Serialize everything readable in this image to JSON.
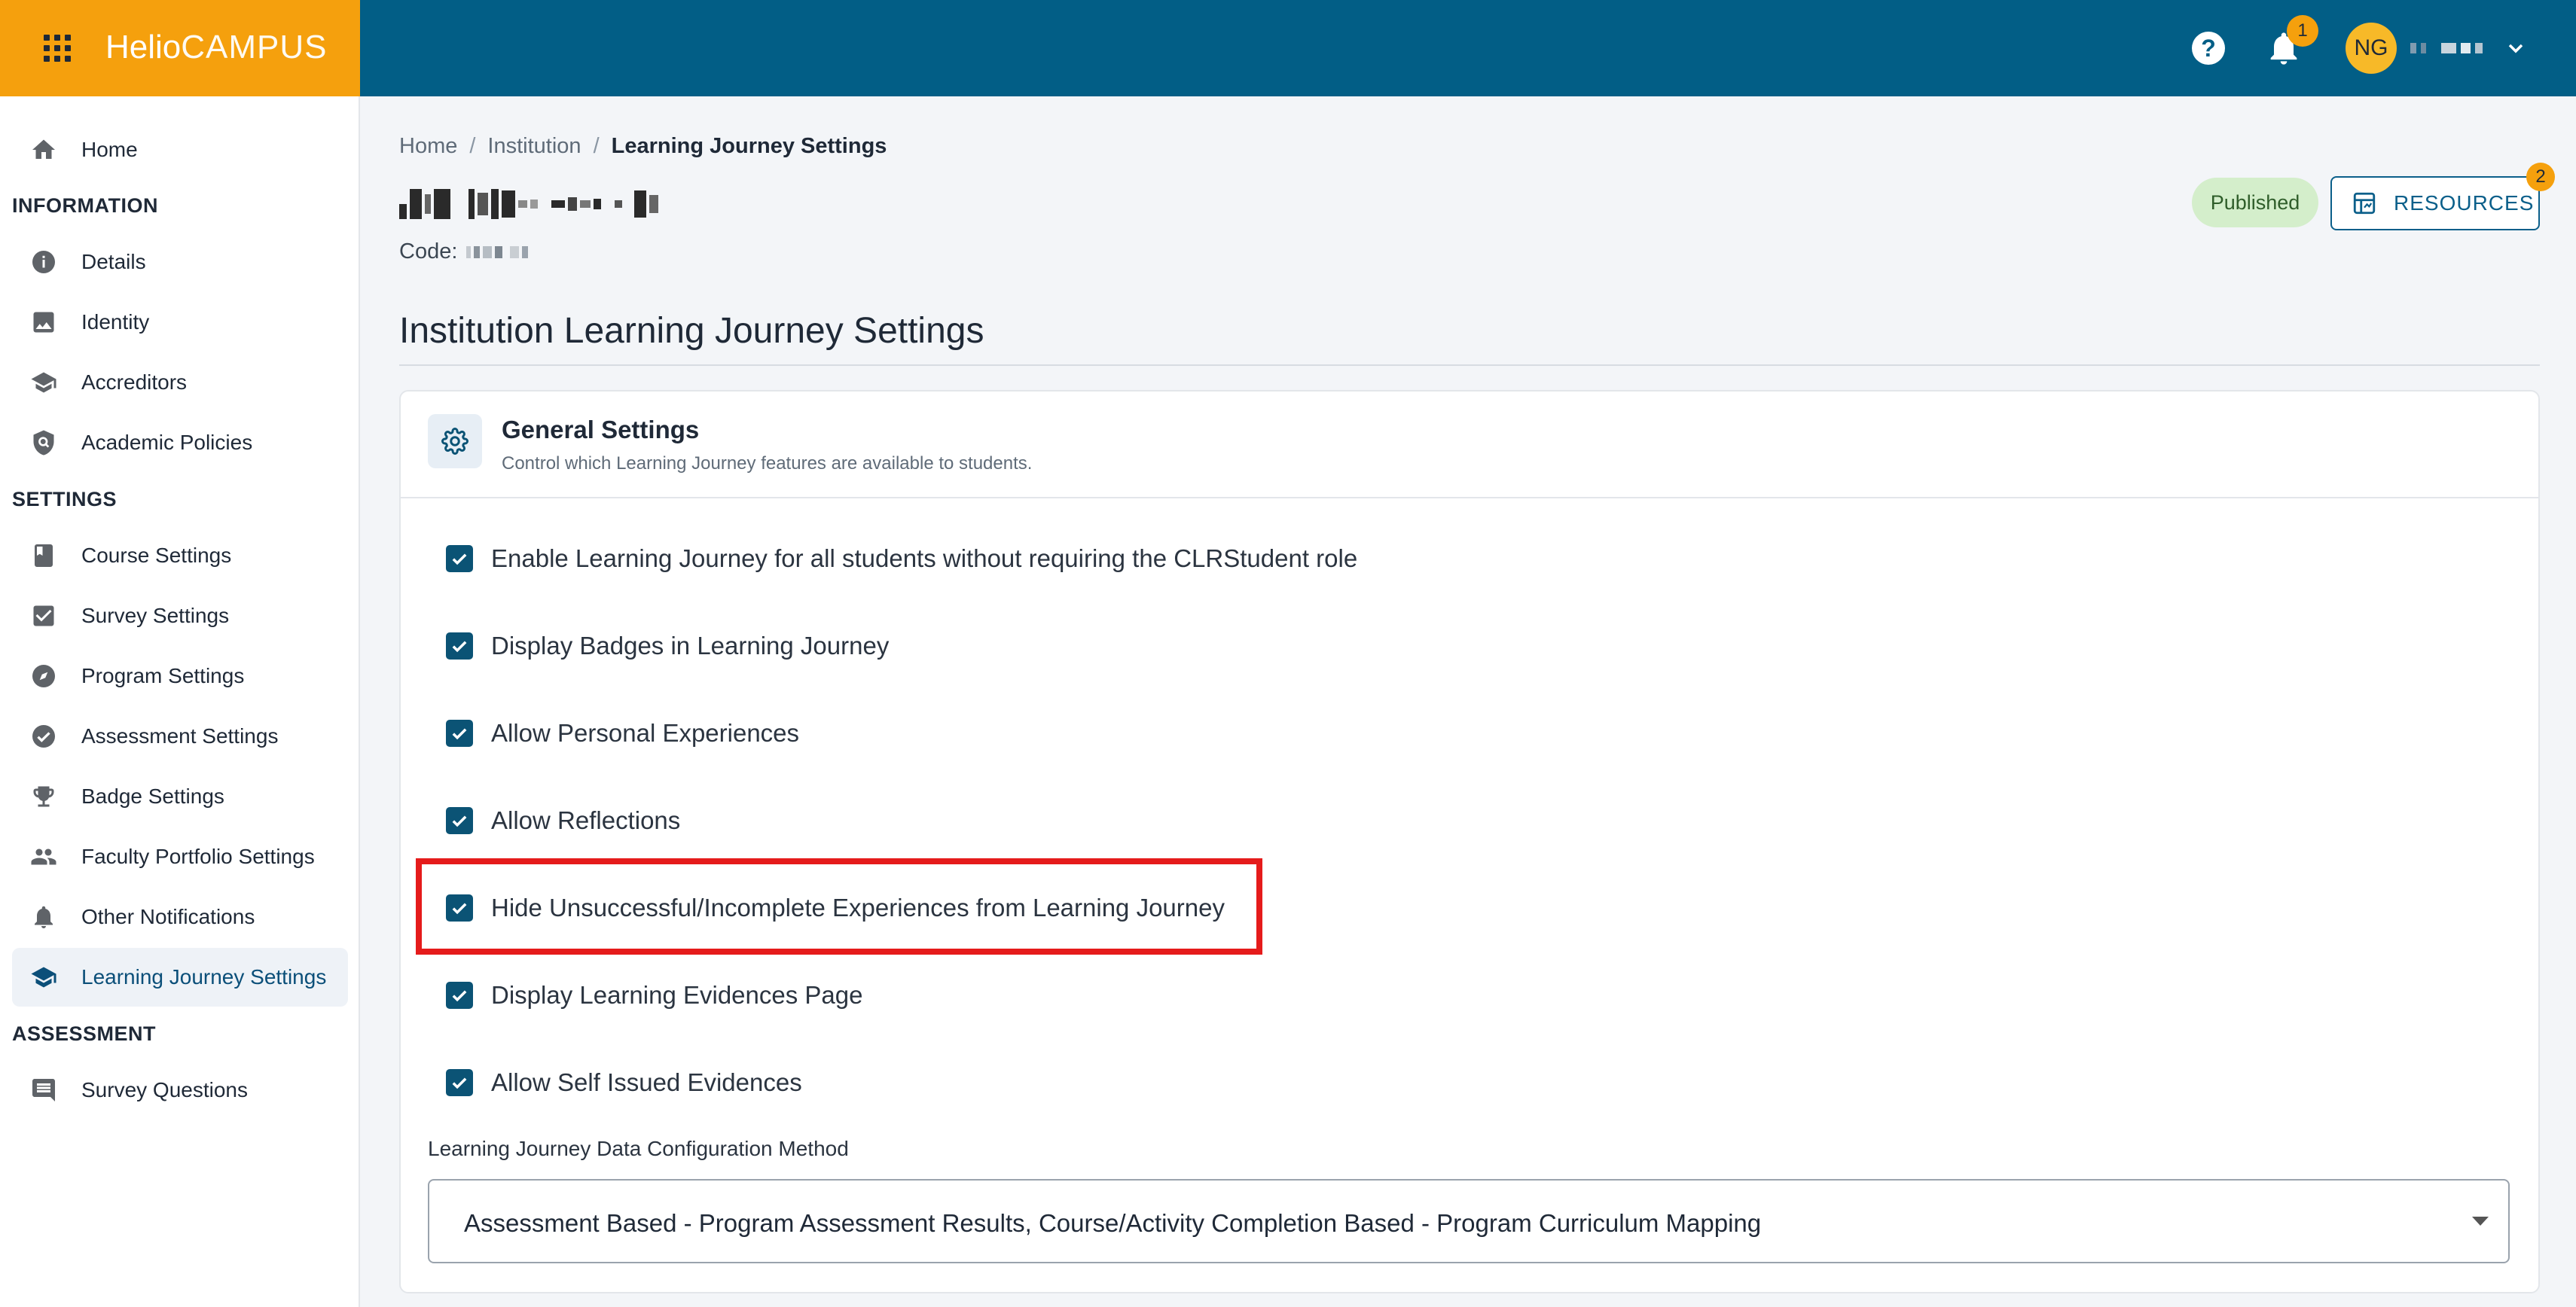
{
  "app": {
    "brand_part1": "Helio",
    "brand_part2": "CAMPUS",
    "brand_color": "#f5a00d",
    "topbar_color": "#025e86",
    "notification_count": "1",
    "user_initials": "NG"
  },
  "sidebar": {
    "home": "Home",
    "section_information": "INFORMATION",
    "details": "Details",
    "identity": "Identity",
    "accreditors": "Accreditors",
    "academic_policies": "Academic Policies",
    "section_settings": "SETTINGS",
    "course_settings": "Course Settings",
    "survey_settings": "Survey Settings",
    "program_settings": "Program Settings",
    "assessment_settings": "Assessment Settings",
    "badge_settings": "Badge Settings",
    "faculty_portfolio_settings": "Faculty Portfolio Settings",
    "other_notifications": "Other Notifications",
    "learning_journey_settings": "Learning Journey Settings",
    "section_assessment": "ASSESSMENT",
    "survey_questions": "Survey Questions"
  },
  "breadcrumb": {
    "home": "Home",
    "institution": "Institution",
    "current": "Learning Journey Settings",
    "separator": "/"
  },
  "header": {
    "code_label": "Code:",
    "status": "Published",
    "resources_label": "RESOURCES",
    "resources_count": "2"
  },
  "page": {
    "title": "Institution Learning Journey Settings"
  },
  "general_settings": {
    "title": "General Settings",
    "subtitle": "Control which Learning Journey features are available to students.",
    "options": [
      {
        "label": "Enable Learning Journey for all students without requiring the CLRStudent role",
        "checked": true
      },
      {
        "label": "Display Badges in Learning Journey",
        "checked": true
      },
      {
        "label": "Allow Personal Experiences",
        "checked": true
      },
      {
        "label": "Allow Reflections",
        "checked": true
      },
      {
        "label": "Hide Unsuccessful/Incomplete Experiences from Learning Journey",
        "checked": true
      },
      {
        "label": "Display Learning Evidences Page",
        "checked": true
      },
      {
        "label": "Allow Self Issued Evidences",
        "checked": true
      }
    ],
    "config_label": "Learning Journey Data Configuration Method",
    "config_value": "Assessment Based - Program Assessment Results, Course/Activity Completion Based - Program Curriculum Mapping"
  }
}
